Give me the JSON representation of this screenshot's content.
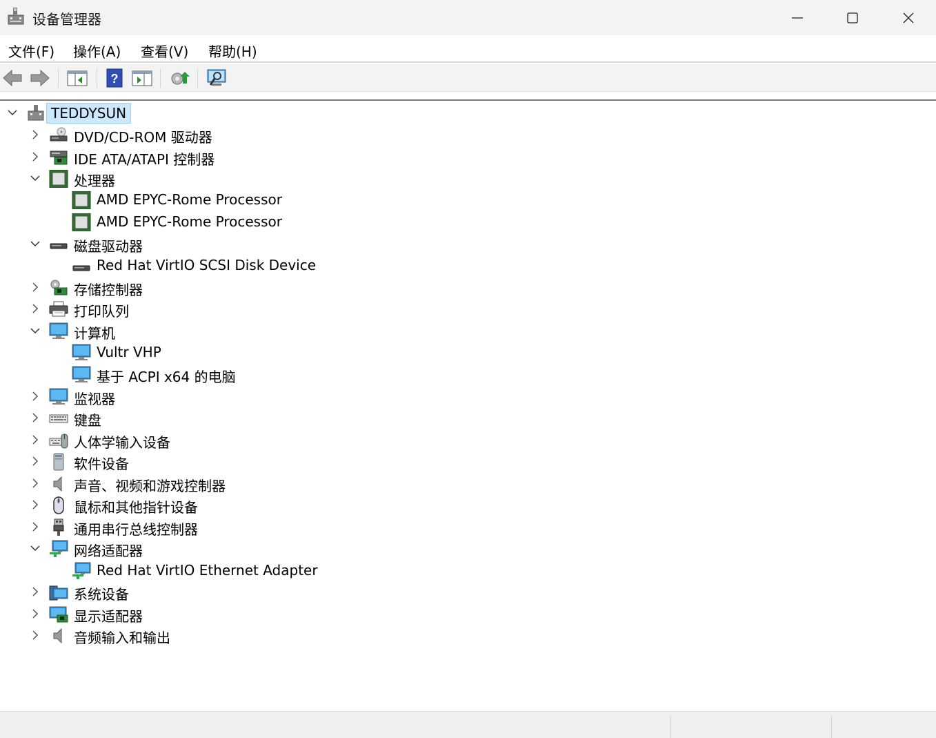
{
  "window": {
    "title": "设备管理器"
  },
  "menu": {
    "file": "文件(F)",
    "action": "操作(A)",
    "view": "查看(V)",
    "help": "帮助(H)"
  },
  "tree": {
    "root": "TEDDYSUN",
    "dvd": "DVD/CD-ROM 驱动器",
    "ide": "IDE ATA/ATAPI 控制器",
    "processors": "处理器",
    "processor1": "AMD EPYC-Rome Processor",
    "processor2": "AMD EPYC-Rome Processor",
    "disk_drives": "磁盘驱动器",
    "disk1": "Red Hat VirtIO SCSI Disk Device",
    "storage": "存储控制器",
    "print_queue": "打印队列",
    "computer": "计算机",
    "computer1": "Vultr VHP",
    "computer2": "基于 ACPI x64 的电脑",
    "monitors": "监视器",
    "keyboards": "键盘",
    "hid": "人体学输入设备",
    "software_devices": "软件设备",
    "sound": "声音、视频和游戏控制器",
    "mice": "鼠标和其他指针设备",
    "usb": "通用串行总线控制器",
    "network": "网络适配器",
    "network1": "Red Hat VirtIO Ethernet Adapter",
    "system": "系统设备",
    "display": "显示适配器",
    "audio_io": "音频输入和输出"
  },
  "icons": {
    "back": "arrow-left-icon",
    "forward": "arrow-right-icon",
    "properties": "properties-icon",
    "help": "help-icon",
    "show_hide": "console-tree-icon",
    "update": "update-driver-icon",
    "scan": "scan-hardware-icon"
  },
  "colors": {
    "selection": "#cce8ff",
    "selection_border": "#99d1ff",
    "titlebar": "#f3f3f3"
  }
}
